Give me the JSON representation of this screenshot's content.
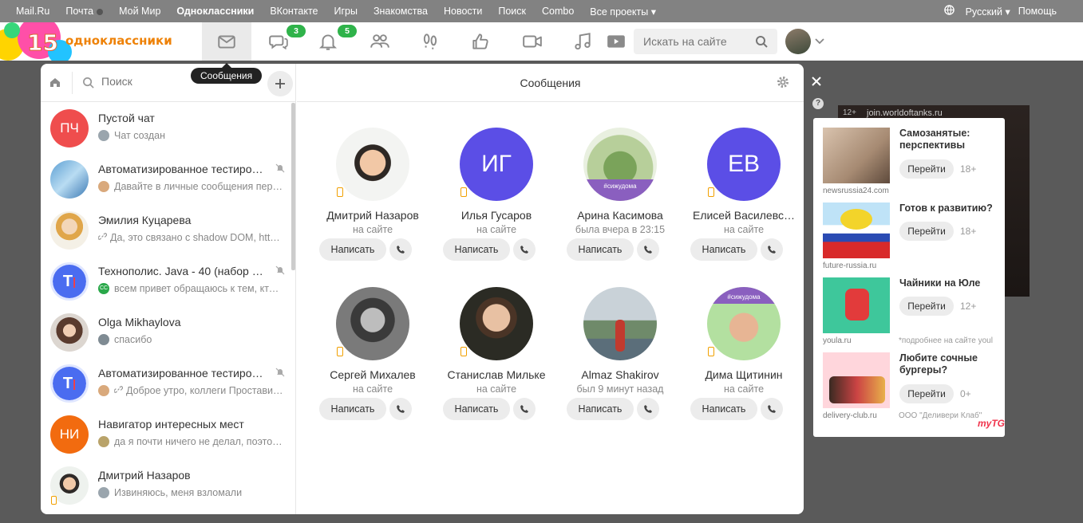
{
  "portal": {
    "links": [
      "Mail.Ru",
      "Почта",
      "Мой Мир",
      "Одноклассники",
      "ВКонтакте",
      "Игры",
      "Знакомства",
      "Новости",
      "Поиск",
      "Combo"
    ],
    "all_projects": "Все проекты",
    "language": "Русский",
    "help": "Помощь"
  },
  "header": {
    "logo_number": "15",
    "logo_text": "одноклассники",
    "discussions_badge": "3",
    "notifications_badge": "5",
    "search_placeholder": "Искать на сайте"
  },
  "tooltip": "Сообщения",
  "messenger": {
    "search_placeholder": "Поиск",
    "title": "Сообщения",
    "chats": [
      {
        "name": "Пустой чат",
        "preview": "Чат создан",
        "initials": "ПЧ",
        "color": "#ef4d4d"
      },
      {
        "name": "Автоматизированное тестиро…",
        "preview": "Давайте в личные сообщения пере…"
      },
      {
        "name": "Эмилия Куцарева",
        "preview": "Да, это связано с shadow DOM, https…"
      },
      {
        "name": "Технополис. Java - 40 (набор …",
        "preview": "всем привет обращаюсь к тем, кто …",
        "mini_text": "CC"
      },
      {
        "name": "Olga Mikhaylova",
        "preview": "спасибо"
      },
      {
        "name": "Автоматизированное тестиро…",
        "preview": "Доброе утро, коллеги Проставил…"
      },
      {
        "name": "Навигатор интересных мест",
        "preview": "да я почти ничего не делал, поэтом…",
        "initials": "НИ",
        "color": "#f26b0f"
      },
      {
        "name": "Дмитрий Назаров",
        "preview": "Извиняюсь, меня взломали"
      }
    ],
    "friends": [
      {
        "name": "Дмитрий Назаров",
        "status": "на сайте",
        "write": "Написать"
      },
      {
        "name": "Илья Гусаров",
        "status": "на сайте",
        "write": "Написать",
        "initials": "ИГ",
        "color": "#5b4ee6"
      },
      {
        "name": "Арина Касимова",
        "status": "была вчера в 23:15",
        "write": "Написать",
        "tag": "#сижудома"
      },
      {
        "name": "Елисей Василевс…",
        "status": "на сайте",
        "write": "Написать",
        "initials": "ЕВ",
        "color": "#5b4ee6"
      },
      {
        "name": "Сергей Михалев",
        "status": "на сайте",
        "write": "Написать"
      },
      {
        "name": "Станислав Мильке",
        "status": "на сайте",
        "write": "Написать"
      },
      {
        "name": "Almaz Shakirov",
        "status": "был 9 минут назад",
        "write": "Написать"
      },
      {
        "name": "Дима Щитинин",
        "status": "на сайте",
        "write": "Написать",
        "tag": "#сижудома"
      }
    ]
  },
  "right_banner": {
    "age": "12+",
    "url": "join.worldoftanks.ru"
  },
  "help_mark": "?",
  "ads": [
    {
      "title": "Самозанятые: перспективы",
      "go": "Перейти",
      "age": "18+",
      "domain": "newsrussia24.com",
      "extra": ""
    },
    {
      "title": "Готов к развитию?",
      "go": "Перейти",
      "age": "18+",
      "domain": "future-russia.ru",
      "extra": ""
    },
    {
      "title": "Чайники на Юле",
      "go": "Перейти",
      "age": "12+",
      "domain": "youla.ru",
      "extra": "*подробнее на сайте youla"
    },
    {
      "title": "Любите сочные бургеры?",
      "go": "Перейти",
      "age": "0+",
      "domain": "delivery-club.ru",
      "extra": "ООО \"Деливери Клаб\""
    }
  ],
  "mytarget": "myTG"
}
